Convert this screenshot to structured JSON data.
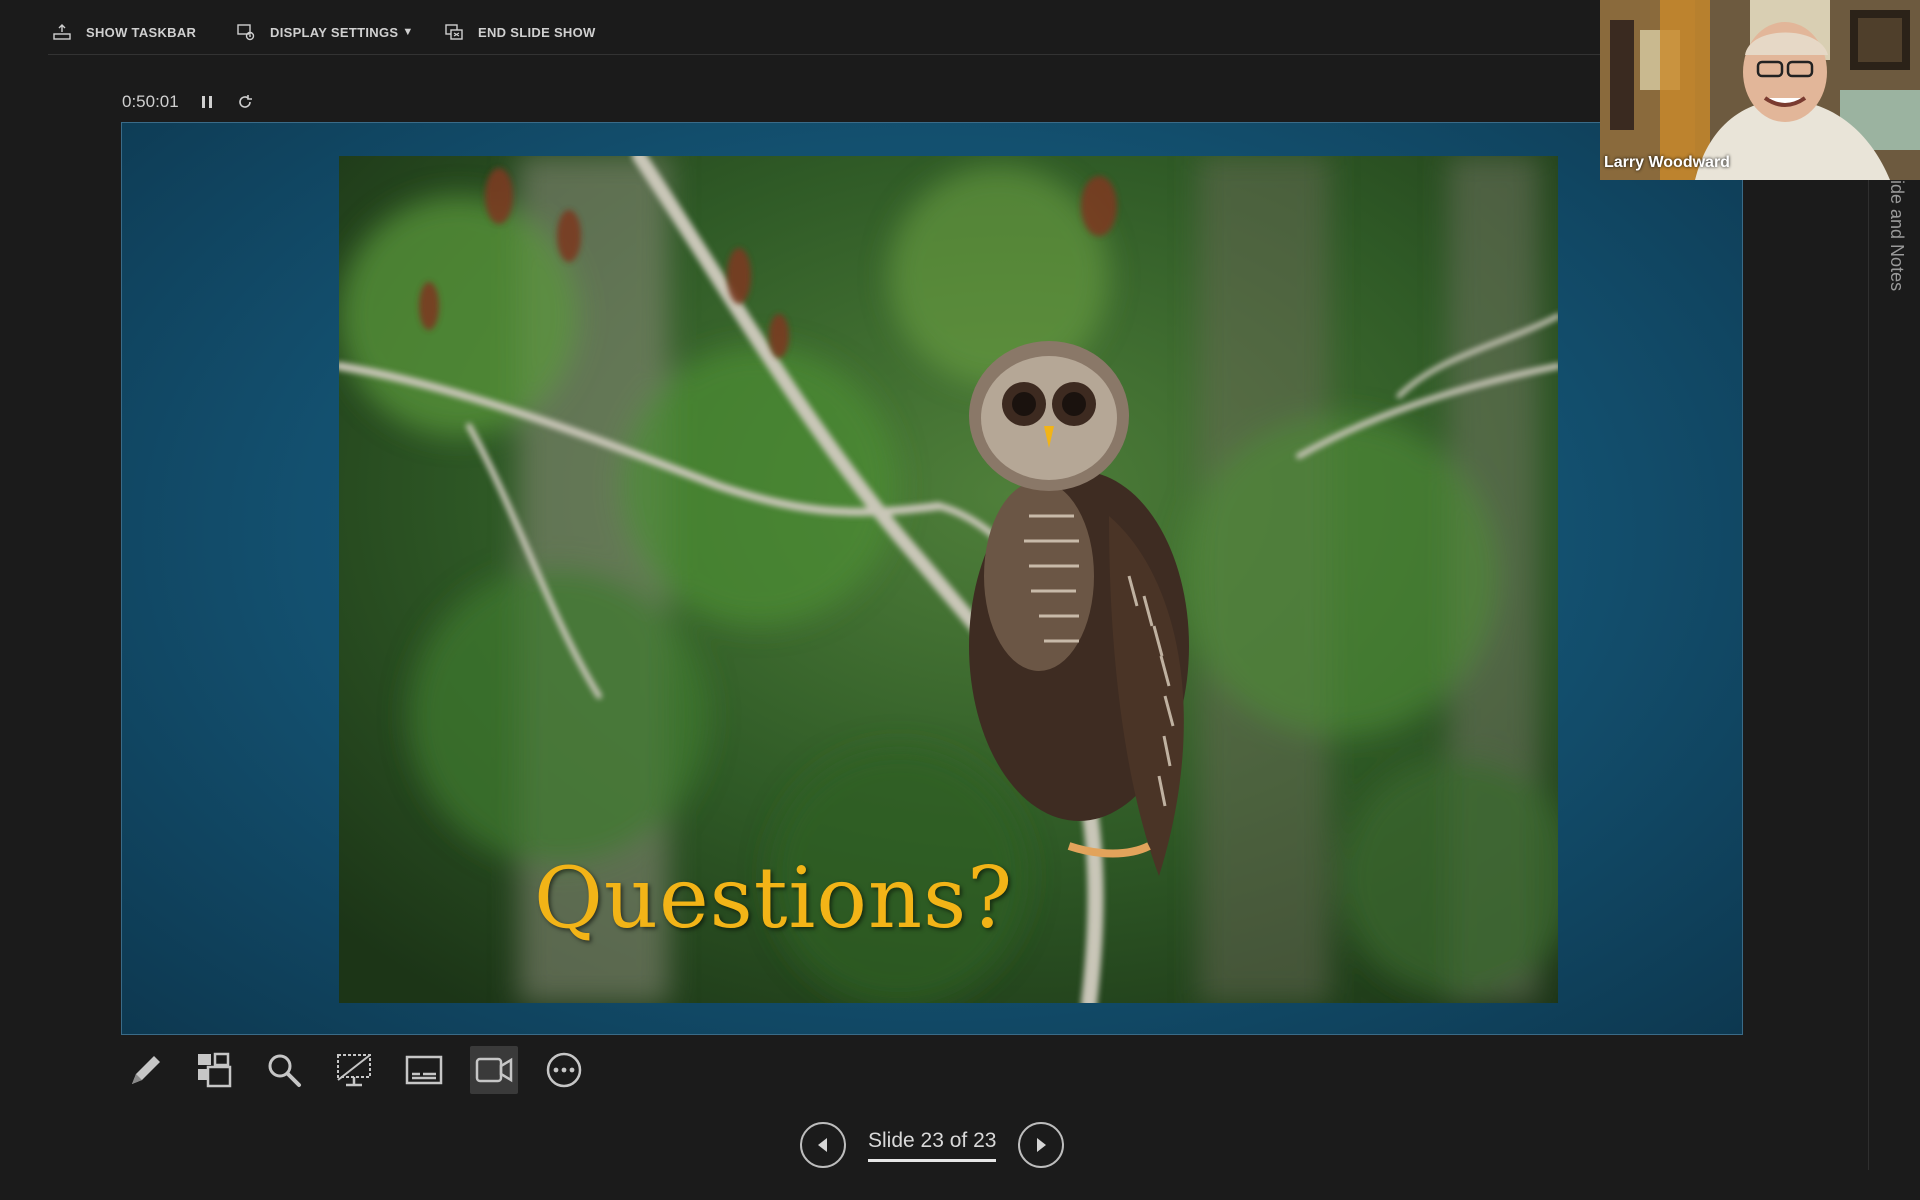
{
  "toolbar": {
    "show_taskbar": "SHOW TASKBAR",
    "display_settings": "DISPLAY SETTINGS",
    "end_slide_show": "END SLIDE SHOW"
  },
  "timer": {
    "elapsed": "0:50:01"
  },
  "slide": {
    "title": "Questions?"
  },
  "video": {
    "participant_name": "Larry Woodward"
  },
  "side_panel": {
    "label": "ide and Notes"
  },
  "navigation": {
    "counter": "Slide 23 of 23"
  },
  "colors": {
    "slide_background": "#13506f",
    "title": "#f2b417",
    "app_background": "#1b1b1b"
  },
  "icons": {
    "tools": [
      "pen-icon",
      "slide-sorter-icon",
      "zoom-icon",
      "laser-screen-icon",
      "subtitles-icon",
      "camera-icon",
      "more-options-icon"
    ]
  }
}
